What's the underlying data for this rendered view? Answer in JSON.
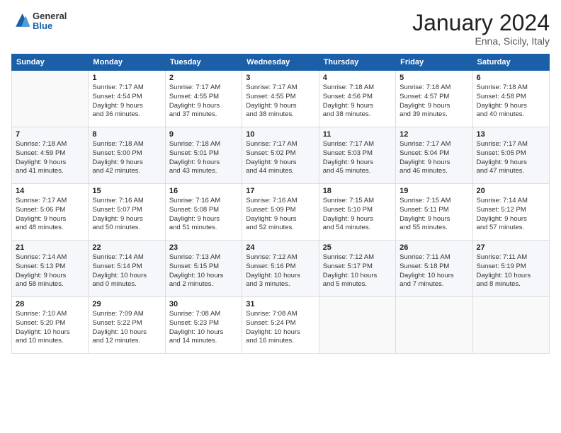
{
  "header": {
    "logo_general": "General",
    "logo_blue": "Blue",
    "month": "January 2024",
    "location": "Enna, Sicily, Italy"
  },
  "days_of_week": [
    "Sunday",
    "Monday",
    "Tuesday",
    "Wednesday",
    "Thursday",
    "Friday",
    "Saturday"
  ],
  "weeks": [
    [
      {
        "day": "",
        "content": ""
      },
      {
        "day": "1",
        "content": "Sunrise: 7:17 AM\nSunset: 4:54 PM\nDaylight: 9 hours\nand 36 minutes."
      },
      {
        "day": "2",
        "content": "Sunrise: 7:17 AM\nSunset: 4:55 PM\nDaylight: 9 hours\nand 37 minutes."
      },
      {
        "day": "3",
        "content": "Sunrise: 7:17 AM\nSunset: 4:55 PM\nDaylight: 9 hours\nand 38 minutes."
      },
      {
        "day": "4",
        "content": "Sunrise: 7:18 AM\nSunset: 4:56 PM\nDaylight: 9 hours\nand 38 minutes."
      },
      {
        "day": "5",
        "content": "Sunrise: 7:18 AM\nSunset: 4:57 PM\nDaylight: 9 hours\nand 39 minutes."
      },
      {
        "day": "6",
        "content": "Sunrise: 7:18 AM\nSunset: 4:58 PM\nDaylight: 9 hours\nand 40 minutes."
      }
    ],
    [
      {
        "day": "7",
        "content": "Sunrise: 7:18 AM\nSunset: 4:59 PM\nDaylight: 9 hours\nand 41 minutes."
      },
      {
        "day": "8",
        "content": "Sunrise: 7:18 AM\nSunset: 5:00 PM\nDaylight: 9 hours\nand 42 minutes."
      },
      {
        "day": "9",
        "content": "Sunrise: 7:18 AM\nSunset: 5:01 PM\nDaylight: 9 hours\nand 43 minutes."
      },
      {
        "day": "10",
        "content": "Sunrise: 7:17 AM\nSunset: 5:02 PM\nDaylight: 9 hours\nand 44 minutes."
      },
      {
        "day": "11",
        "content": "Sunrise: 7:17 AM\nSunset: 5:03 PM\nDaylight: 9 hours\nand 45 minutes."
      },
      {
        "day": "12",
        "content": "Sunrise: 7:17 AM\nSunset: 5:04 PM\nDaylight: 9 hours\nand 46 minutes."
      },
      {
        "day": "13",
        "content": "Sunrise: 7:17 AM\nSunset: 5:05 PM\nDaylight: 9 hours\nand 47 minutes."
      }
    ],
    [
      {
        "day": "14",
        "content": "Sunrise: 7:17 AM\nSunset: 5:06 PM\nDaylight: 9 hours\nand 48 minutes."
      },
      {
        "day": "15",
        "content": "Sunrise: 7:16 AM\nSunset: 5:07 PM\nDaylight: 9 hours\nand 50 minutes."
      },
      {
        "day": "16",
        "content": "Sunrise: 7:16 AM\nSunset: 5:08 PM\nDaylight: 9 hours\nand 51 minutes."
      },
      {
        "day": "17",
        "content": "Sunrise: 7:16 AM\nSunset: 5:09 PM\nDaylight: 9 hours\nand 52 minutes."
      },
      {
        "day": "18",
        "content": "Sunrise: 7:15 AM\nSunset: 5:10 PM\nDaylight: 9 hours\nand 54 minutes."
      },
      {
        "day": "19",
        "content": "Sunrise: 7:15 AM\nSunset: 5:11 PM\nDaylight: 9 hours\nand 55 minutes."
      },
      {
        "day": "20",
        "content": "Sunrise: 7:14 AM\nSunset: 5:12 PM\nDaylight: 9 hours\nand 57 minutes."
      }
    ],
    [
      {
        "day": "21",
        "content": "Sunrise: 7:14 AM\nSunset: 5:13 PM\nDaylight: 9 hours\nand 58 minutes."
      },
      {
        "day": "22",
        "content": "Sunrise: 7:14 AM\nSunset: 5:14 PM\nDaylight: 10 hours\nand 0 minutes."
      },
      {
        "day": "23",
        "content": "Sunrise: 7:13 AM\nSunset: 5:15 PM\nDaylight: 10 hours\nand 2 minutes."
      },
      {
        "day": "24",
        "content": "Sunrise: 7:12 AM\nSunset: 5:16 PM\nDaylight: 10 hours\nand 3 minutes."
      },
      {
        "day": "25",
        "content": "Sunrise: 7:12 AM\nSunset: 5:17 PM\nDaylight: 10 hours\nand 5 minutes."
      },
      {
        "day": "26",
        "content": "Sunrise: 7:11 AM\nSunset: 5:18 PM\nDaylight: 10 hours\nand 7 minutes."
      },
      {
        "day": "27",
        "content": "Sunrise: 7:11 AM\nSunset: 5:19 PM\nDaylight: 10 hours\nand 8 minutes."
      }
    ],
    [
      {
        "day": "28",
        "content": "Sunrise: 7:10 AM\nSunset: 5:20 PM\nDaylight: 10 hours\nand 10 minutes."
      },
      {
        "day": "29",
        "content": "Sunrise: 7:09 AM\nSunset: 5:22 PM\nDaylight: 10 hours\nand 12 minutes."
      },
      {
        "day": "30",
        "content": "Sunrise: 7:08 AM\nSunset: 5:23 PM\nDaylight: 10 hours\nand 14 minutes."
      },
      {
        "day": "31",
        "content": "Sunrise: 7:08 AM\nSunset: 5:24 PM\nDaylight: 10 hours\nand 16 minutes."
      },
      {
        "day": "",
        "content": ""
      },
      {
        "day": "",
        "content": ""
      },
      {
        "day": "",
        "content": ""
      }
    ]
  ]
}
